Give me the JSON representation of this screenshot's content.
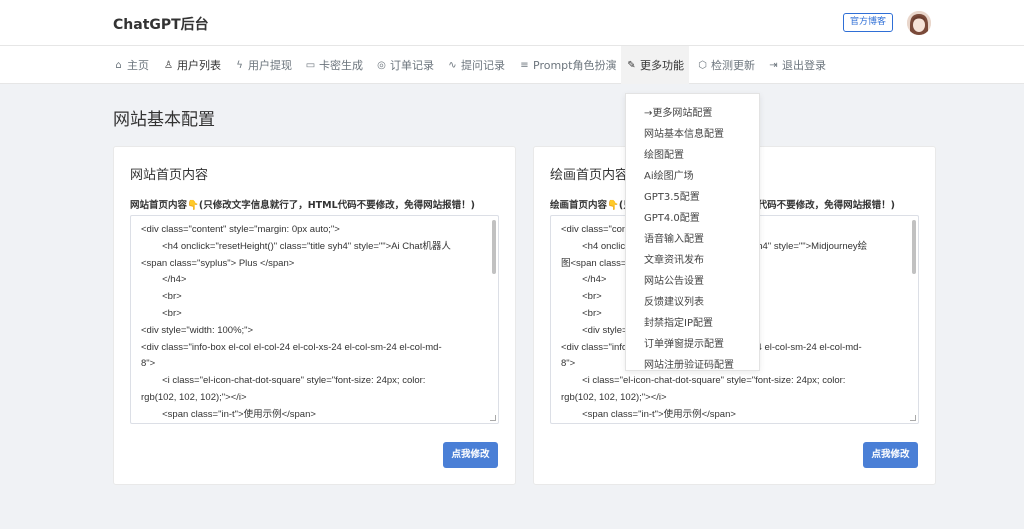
{
  "app": {
    "brand": "ChatGPT后台",
    "blog_button": "官方博客"
  },
  "nav": [
    {
      "icon": "⌂",
      "label": "主页"
    },
    {
      "icon": "♙",
      "label": "用户列表"
    },
    {
      "icon": "ϟ",
      "label": "用户提现"
    },
    {
      "icon": "▭",
      "label": "卡密生成"
    },
    {
      "icon": "◎",
      "label": "订单记录"
    },
    {
      "icon": "∿",
      "label": "提问记录"
    },
    {
      "icon": "≡",
      "label": "Prompt角色扮演"
    },
    {
      "icon": "✎",
      "label": "更多功能"
    },
    {
      "icon": "⬡",
      "label": "检测更新"
    },
    {
      "icon": "⇥",
      "label": "退出登录"
    }
  ],
  "page": {
    "title": "网站基本配置"
  },
  "cards": [
    {
      "title": "网站首页内容",
      "note_prefix": "网站首页内容",
      "note_suffix": "(只修改文字信息就行了，HTML代码不要修改，免得网站报错！)",
      "lines": [
        "<div class=\"content\" style=\"margin: 0px auto;\">",
        "        <h4 onclick=\"resetHeight()\" class=\"title syh4\" style=\"\">Ai Chat机器人",
        "<span class=\"syplus\"> Plus </span>",
        "        </h4>",
        "        <br>",
        "        <br>",
        "<div style=\"width: 100%;\">",
        "<div class=\"info-box el-col el-col-24 el-col-xs-24 el-col-sm-24 el-col-md-",
        "8\">",
        "        <i class=\"el-icon-chat-dot-square\" style=\"font-size: 24px; color:",
        "rgb(102, 102, 102);\"></i>",
        "        <span class=\"in-t\">使用示例</span>"
      ],
      "button": "点我修改"
    },
    {
      "title": "绘画首页内容",
      "note_prefix": "绘画首页内容",
      "note_suffix": "(只修改文字信息就行了，HTML代码不要修改，免得网站报错！)",
      "lines": [
        "<div class=\"content\" style=\"margin: 0px auto;\">",
        "        <h4 onclick=\"resetHeight()\" class=\"title syh4\" style=\"\">Midjourney绘",
        "图<span class=\"syplus\"> Plus </span>",
        "        </h4>",
        "        <br>",
        "        <br>",
        "        <div style=\"width: 100%;\">",
        "<div class=\"info-box el-col el-col-24 el-col-xs-24 el-col-sm-24 el-col-md-",
        "8\">",
        "        <i class=\"el-icon-chat-dot-square\" style=\"font-size: 24px; color:",
        "rgb(102, 102, 102);\"></i>",
        "        <span class=\"in-t\">使用示例</span>"
      ],
      "button": "点我修改"
    }
  ],
  "dropdown": [
    "→更多网站配置",
    "网站基本信息配置",
    "绘图配置",
    "Ai绘图广场",
    "GPT3.5配置",
    "GPT4.0配置",
    "语音输入配置",
    "文章资讯发布",
    "网站公告设置",
    "反馈建议列表",
    "封禁指定IP配置",
    "订单弹窗提示配置",
    "网站注册验证码配置"
  ],
  "colors": {
    "accent": "#4a7fd6",
    "blog_border": "#2f6fd6",
    "background": "#f0f2f5"
  }
}
